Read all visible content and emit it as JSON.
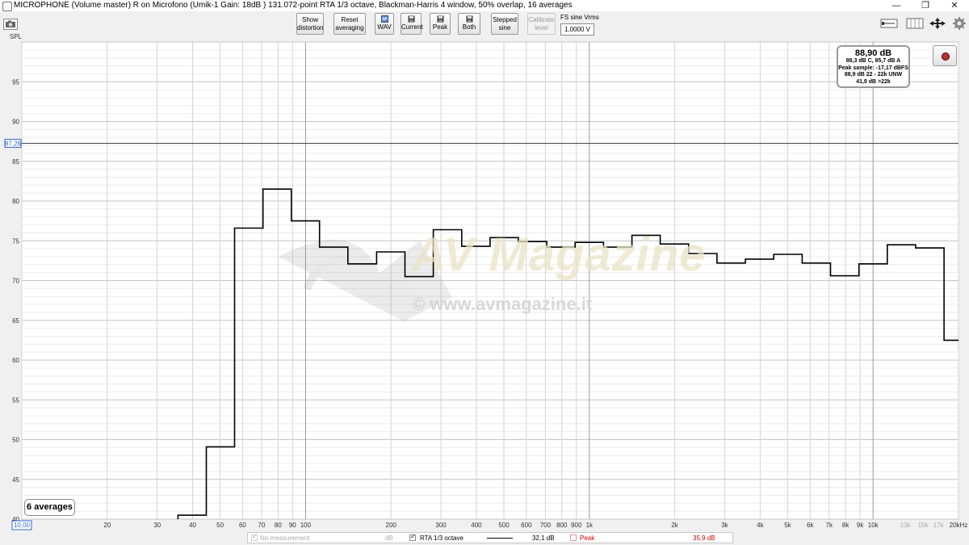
{
  "window": {
    "title": "MICROPHONE (Volume master) R on Microfono (Umik-1  Gain: 18dB  ) 131.072-point RTA 1/3 octave, Blackman-Harris 4 window, 50% overlap, 16 averages",
    "minimize": "—",
    "restore": "❐",
    "close": "✕"
  },
  "toolbar": {
    "show_distortion": "Show distortion",
    "reset_averaging": "Reset averaging",
    "wav": "WAV",
    "current": "Current",
    "peak": "Peak",
    "both": "Both",
    "stepped_sine": "Stepped sine",
    "calibrate_level": "Calibrate level",
    "fs_sine_label": "FS sine Vrms",
    "fs_sine_value": "1,0000 V"
  },
  "readout": {
    "main": "88,90 dB",
    "line1": "88,3 dB C, 85,7 dB A",
    "line2": "Peak sample: -17,17 dBFS",
    "line3": "88,9 dB 22 - 22k UNW",
    "line4": "41,9 dB >22k"
  },
  "averages_badge": "6 averages",
  "legend": {
    "no_measurement": "No measurement",
    "no_measurement_unit": "dB",
    "rta_label": "RTA 1/3 octave",
    "rta_value": "32,1 dB",
    "peak_label": "Peak",
    "peak_value": "35,9 dB",
    "peak_color": "#cc0000"
  },
  "watermark": {
    "brand": "AV Magazine",
    "url": "© www.avmagazine.it"
  },
  "chart_data": {
    "type": "line",
    "ylabel": "SPL",
    "xscale": "log",
    "xlim": [
      10,
      20000
    ],
    "ylim": [
      40,
      100
    ],
    "y_ticks": [
      40,
      45,
      50,
      55,
      60,
      65,
      70,
      75,
      80,
      85,
      90,
      95
    ],
    "x_ticks": [
      {
        "v": 20,
        "label": "20"
      },
      {
        "v": 30,
        "label": "30"
      },
      {
        "v": 40,
        "label": "40"
      },
      {
        "v": 50,
        "label": "50"
      },
      {
        "v": 60,
        "label": "60"
      },
      {
        "v": 70,
        "label": "70"
      },
      {
        "v": 80,
        "label": "80"
      },
      {
        "v": 90,
        "label": "90"
      },
      {
        "v": 100,
        "label": "100"
      },
      {
        "v": 200,
        "label": "200"
      },
      {
        "v": 300,
        "label": "300"
      },
      {
        "v": 400,
        "label": "400"
      },
      {
        "v": 500,
        "label": "500"
      },
      {
        "v": 600,
        "label": "600"
      },
      {
        "v": 700,
        "label": "700"
      },
      {
        "v": 800,
        "label": "800"
      },
      {
        "v": 900,
        "label": "900"
      },
      {
        "v": 1000,
        "label": "1k"
      },
      {
        "v": 2000,
        "label": "2k"
      },
      {
        "v": 3000,
        "label": "3k"
      },
      {
        "v": 4000,
        "label": "4k"
      },
      {
        "v": 5000,
        "label": "5k"
      },
      {
        "v": 6000,
        "label": "6k"
      },
      {
        "v": 7000,
        "label": "7k"
      },
      {
        "v": 8000,
        "label": "8k"
      },
      {
        "v": 9000,
        "label": "9k"
      },
      {
        "v": 10000,
        "label": "10k"
      },
      {
        "v": 13000,
        "label": "13k",
        "grey": true
      },
      {
        "v": 15000,
        "label": "15k",
        "grey": true
      },
      {
        "v": 17000,
        "label": "17k",
        "grey": true
      },
      {
        "v": 20000,
        "label": "20kHz"
      }
    ],
    "x_min_label": "10,00",
    "cursor_y": 87.26,
    "cursor_y_label": "87,26",
    "series": [
      {
        "name": "RTA 1/3 octave",
        "color": "#000000",
        "step": true,
        "bands": [
          {
            "f0": 35.5,
            "f1": 44.7,
            "v": 40.5
          },
          {
            "f0": 44.7,
            "f1": 56.2,
            "v": 49.1
          },
          {
            "f0": 56.2,
            "f1": 70.8,
            "v": 76.6
          },
          {
            "f0": 70.8,
            "f1": 89.1,
            "v": 81.5
          },
          {
            "f0": 89.1,
            "f1": 112,
            "v": 77.5
          },
          {
            "f0": 112,
            "f1": 141,
            "v": 74.2
          },
          {
            "f0": 141,
            "f1": 178,
            "v": 72.1
          },
          {
            "f0": 178,
            "f1": 224,
            "v": 73.6
          },
          {
            "f0": 224,
            "f1": 282,
            "v": 70.5
          },
          {
            "f0": 282,
            "f1": 355,
            "v": 76.4
          },
          {
            "f0": 355,
            "f1": 447,
            "v": 74.3
          },
          {
            "f0": 447,
            "f1": 562,
            "v": 75.4
          },
          {
            "f0": 562,
            "f1": 708,
            "v": 74.9
          },
          {
            "f0": 708,
            "f1": 891,
            "v": 74.2
          },
          {
            "f0": 891,
            "f1": 1122,
            "v": 74.8
          },
          {
            "f0": 1122,
            "f1": 1413,
            "v": 74.2
          },
          {
            "f0": 1413,
            "f1": 1778,
            "v": 75.7
          },
          {
            "f0": 1778,
            "f1": 2239,
            "v": 74.6
          },
          {
            "f0": 2239,
            "f1": 2818,
            "v": 73.4
          },
          {
            "f0": 2818,
            "f1": 3548,
            "v": 72.2
          },
          {
            "f0": 3548,
            "f1": 4467,
            "v": 72.7
          },
          {
            "f0": 4467,
            "f1": 5623,
            "v": 73.3
          },
          {
            "f0": 5623,
            "f1": 7079,
            "v": 72.2
          },
          {
            "f0": 7079,
            "f1": 8913,
            "v": 70.6
          },
          {
            "f0": 8913,
            "f1": 11220,
            "v": 72.1
          },
          {
            "f0": 11220,
            "f1": 14125,
            "v": 74.5
          },
          {
            "f0": 14125,
            "f1": 17783,
            "v": 74.1
          },
          {
            "f0": 17783,
            "f1": 20000,
            "v": 62.5
          }
        ]
      }
    ]
  }
}
